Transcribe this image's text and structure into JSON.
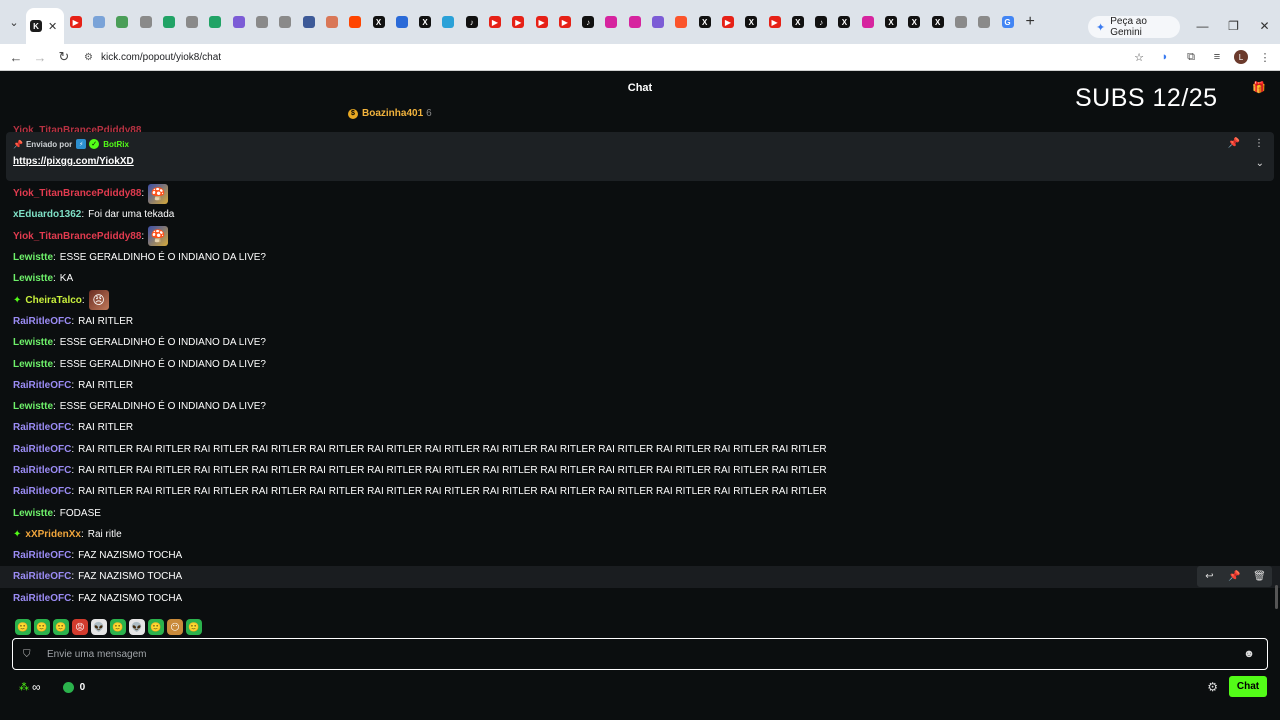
{
  "browser": {
    "tabs": [
      {
        "icon": "kick-icon",
        "color": "#1b1b1b",
        "glyph": "K"
      },
      {
        "icon": "youtube-icon",
        "color": "#e62117",
        "glyph": "▶"
      },
      {
        "icon": "page-icon",
        "color": "#7aa3d8",
        "glyph": ""
      },
      {
        "icon": "page-icon",
        "color": "#4a9e58",
        "glyph": ""
      },
      {
        "icon": "chatgpt-icon",
        "color": "#8a8a8a",
        "glyph": ""
      },
      {
        "icon": "sheets-icon",
        "color": "#21a366",
        "glyph": ""
      },
      {
        "icon": "chatgpt-icon",
        "color": "#8a8a8a",
        "glyph": ""
      },
      {
        "icon": "sheets-icon",
        "color": "#21a366",
        "glyph": ""
      },
      {
        "icon": "pen-icon",
        "color": "#7c5cd6",
        "glyph": ""
      },
      {
        "icon": "chatgpt-icon",
        "color": "#8a8a8a",
        "glyph": ""
      },
      {
        "icon": "chatgpt-icon",
        "color": "#8a8a8a",
        "glyph": ""
      },
      {
        "icon": "circle-icon",
        "color": "#3d5a98",
        "glyph": ""
      },
      {
        "icon": "claude-icon",
        "color": "#d97757",
        "glyph": ""
      },
      {
        "icon": "reddit-icon",
        "color": "#ff4500",
        "glyph": ""
      },
      {
        "icon": "x-icon",
        "color": "#111111",
        "glyph": "X"
      },
      {
        "icon": "mail-icon",
        "color": "#2a6ad8",
        "glyph": ""
      },
      {
        "icon": "x-icon",
        "color": "#111111",
        "glyph": "X"
      },
      {
        "icon": "link-icon",
        "color": "#2aa1d8",
        "glyph": ""
      },
      {
        "icon": "tiktok-icon",
        "color": "#111111",
        "glyph": "♪"
      },
      {
        "icon": "youtube-icon",
        "color": "#e62117",
        "glyph": "▶"
      },
      {
        "icon": "youtube-icon",
        "color": "#e62117",
        "glyph": "▶"
      },
      {
        "icon": "youtube-icon",
        "color": "#e62117",
        "glyph": "▶"
      },
      {
        "icon": "youtube-icon",
        "color": "#e62117",
        "glyph": "▶"
      },
      {
        "icon": "tiktok-icon",
        "color": "#111111",
        "glyph": "♪"
      },
      {
        "icon": "instagram-icon",
        "color": "#d6249f",
        "glyph": ""
      },
      {
        "icon": "instagram-icon",
        "color": "#d6249f",
        "glyph": ""
      },
      {
        "icon": "pen-icon",
        "color": "#7c5cd6",
        "glyph": ""
      },
      {
        "icon": "brave-icon",
        "color": "#fb542b",
        "glyph": ""
      },
      {
        "icon": "x-icon",
        "color": "#111111",
        "glyph": "X"
      },
      {
        "icon": "youtube-icon",
        "color": "#e62117",
        "glyph": "▶"
      },
      {
        "icon": "x-icon",
        "color": "#111111",
        "glyph": "X"
      },
      {
        "icon": "youtube-icon",
        "color": "#e62117",
        "glyph": "▶"
      },
      {
        "icon": "x-icon",
        "color": "#111111",
        "glyph": "X"
      },
      {
        "icon": "tiktok-icon",
        "color": "#111111",
        "glyph": "♪"
      },
      {
        "icon": "x-icon",
        "color": "#111111",
        "glyph": "X"
      },
      {
        "icon": "instagram-icon",
        "color": "#d6249f",
        "glyph": ""
      },
      {
        "icon": "x-icon",
        "color": "#111111",
        "glyph": "X"
      },
      {
        "icon": "x-icon",
        "color": "#111111",
        "glyph": "X"
      },
      {
        "icon": "x-icon",
        "color": "#111111",
        "glyph": "X"
      },
      {
        "icon": "chatgpt-icon",
        "color": "#8a8a8a",
        "glyph": ""
      },
      {
        "icon": "chatgpt-icon",
        "color": "#8a8a8a",
        "glyph": ""
      },
      {
        "icon": "google-icon",
        "color": "#4285f4",
        "glyph": "G"
      }
    ],
    "gemini_label": "Peça ao Gemini",
    "url": "kick.com/popout/yiok8/chat"
  },
  "chat": {
    "title": "Chat",
    "subs_overlay": "SUBS  12/25",
    "gifter": {
      "name": "Boazinha401",
      "count": "6"
    },
    "ghost_top_user": "Yiok_TitanBrancePdiddy88",
    "pinned": {
      "sent_by": "Enviado por",
      "bot_name": "BotRix",
      "link": "https://pixgg.com/YiokXD"
    },
    "messages": [
      {
        "user": "Yiok_TitanBrancePdiddy88",
        "color": "u-red",
        "text": "",
        "emote": "mario"
      },
      {
        "user": "xEduardo1362",
        "color": "u-teal",
        "text": "Foi dar uma tekada"
      },
      {
        "user": "Yiok_TitanBrancePdiddy88",
        "color": "u-red",
        "text": "",
        "emote": "mario"
      },
      {
        "user": "Lewistte",
        "color": "u-green",
        "text": "ESSE GERALDINHO É O INDIANO DA LIVE?"
      },
      {
        "user": "Lewistte",
        "color": "u-green",
        "text": "KA"
      },
      {
        "user": "CheiraTalco",
        "color": "u-lime",
        "text": "",
        "emote": "face",
        "badge": true
      },
      {
        "user": "RaiRitleOFC",
        "color": "u-purple",
        "text": "RAI RITLER"
      },
      {
        "user": "Lewistte",
        "color": "u-green",
        "text": "ESSE GERALDINHO É O INDIANO DA LIVE?"
      },
      {
        "user": "Lewistte",
        "color": "u-green",
        "text": "ESSE GERALDINHO É O INDIANO DA LIVE?"
      },
      {
        "user": "RaiRitleOFC",
        "color": "u-purple",
        "text": "RAI RITLER"
      },
      {
        "user": "Lewistte",
        "color": "u-green",
        "text": "ESSE GERALDINHO É O INDIANO DA LIVE?"
      },
      {
        "user": "RaiRitleOFC",
        "color": "u-purple",
        "text": "RAI RITLER"
      },
      {
        "user": "RaiRitleOFC",
        "color": "u-purple",
        "text": "RAI RITLER RAI RITLER RAI RITLER RAI RITLER RAI RITLER RAI RITLER RAI RITLER RAI RITLER RAI RITLER RAI RITLER RAI RITLER RAI RITLER RAI RITLER"
      },
      {
        "user": "RaiRitleOFC",
        "color": "u-purple",
        "text": "RAI RITLER RAI RITLER RAI RITLER RAI RITLER RAI RITLER RAI RITLER RAI RITLER RAI RITLER RAI RITLER RAI RITLER RAI RITLER RAI RITLER RAI RITLER"
      },
      {
        "user": "RaiRitleOFC",
        "color": "u-purple",
        "text": "RAI RITLER RAI RITLER RAI RITLER RAI RITLER RAI RITLER RAI RITLER RAI RITLER RAI RITLER RAI RITLER RAI RITLER RAI RITLER RAI RITLER RAI RITLER"
      },
      {
        "user": "Lewistte",
        "color": "u-green",
        "text": "FODASE"
      },
      {
        "user": "xXPridenXx",
        "color": "u-orange",
        "text": "Rai ritle",
        "badge": true
      },
      {
        "user": "RaiRitleOFC",
        "color": "u-purple",
        "text": "FAZ NAZISMO TOCHA"
      },
      {
        "user": "RaiRitleOFC",
        "color": "u-purple",
        "text": "FAZ NAZISMO TOCHA",
        "hover": true
      },
      {
        "user": "RaiRitleOFC",
        "color": "u-purple",
        "text": "FAZ NAZISMO TOCHA"
      }
    ],
    "quick_emotes": [
      "🙂",
      "🙂",
      "🙂",
      "😡",
      "👽",
      "🙂",
      "👽",
      "🙂",
      "😶",
      "🙂"
    ],
    "input_placeholder": "Envie uma mensagem",
    "infinite_symbol": "∞",
    "points": "0",
    "send_label": "Chat"
  },
  "colors": {
    "kick_green": "#53fc18",
    "background": "#0b0e0f"
  }
}
